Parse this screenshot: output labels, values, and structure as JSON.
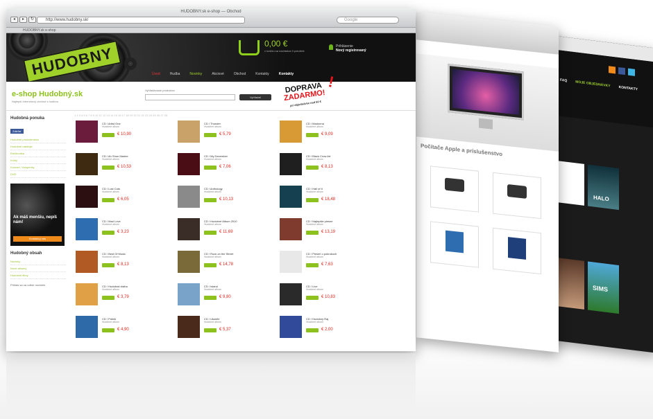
{
  "browser": {
    "window_title": "HUDOBNY.sk e-shop — Obchod",
    "address": "http://www.hudobny.sk/",
    "search_placeholder": "Google",
    "tab_label": "HUDOBNY.sk e-shop"
  },
  "site": {
    "logo": "HUDOBNY",
    "cart_total": "0,00 €",
    "cart_sub": "v košíku sa nachádza 0 položiek",
    "user_line1": "Prihlásenie",
    "user_line2": "Nový registrovaný",
    "menu": [
      "Úvod",
      "Hudba",
      "Novinky",
      "Akciové",
      "Obchod",
      "Kontakty",
      "Kontakty"
    ],
    "brand": "e-shop Hudobný.sk",
    "brand_sub": "Najlepší internetový obchod s hudbou",
    "search_label": "Vyhľadávanie produktov",
    "search_button": "Vyhľadať",
    "promo_line1": "DOPRAVA",
    "promo_line2": "ZADARMO!",
    "promo_line3": "pri objednávke nad 50 €"
  },
  "sidebar": {
    "title": "Hudobná ponuka",
    "fb_label": "Zdieľať",
    "links": [
      "Hudobné príslušenstvo",
      "Hudobné nástroje",
      "Elektronika",
      "Knihy",
      "Koncert, Vstupenky",
      "DVD"
    ],
    "banner_text": "Ak máš menšiu, nepíš nám!",
    "banner_button": "Kontaktuj nás",
    "title2": "Hudobný obsah",
    "links2": [
      "Novinky",
      "Nové albumy",
      "Hudobné filmy"
    ],
    "footer": "Prihlás sa na odber noviniek"
  },
  "pager": "1 2 3 4 5 6 7 8 9 10 11 12 13 14 15 16 17 18 19 20 21 22 23 24 25 26 27 28",
  "products": [
    {
      "name": "CD / Artist One",
      "sub": "Hudobné album",
      "price": "€ 10,90"
    },
    {
      "name": "CD / Thunder",
      "sub": "Hudobné album",
      "price": "€ 5,79"
    },
    {
      "name": "CD / Madonna",
      "sub": "Hudobné album",
      "price": "€ 9,09"
    },
    {
      "name": "CD / Ah Shun Mariee",
      "sub": "Hudobné album",
      "price": "€ 10,53"
    },
    {
      "name": "CD / My December",
      "sub": "Hudobné album",
      "price": "€ 7,06"
    },
    {
      "name": "CD / Black Crow Art",
      "sub": "Hudobné album",
      "price": "€ 8,13"
    },
    {
      "name": "CD / Lost Cuts",
      "sub": "Hudobné album",
      "price": "€ 6,05"
    },
    {
      "name": "CD / Anthology",
      "sub": "Hudobné album",
      "price": "€ 10,13"
    },
    {
      "name": "CD / Hall of It",
      "sub": "Hudobné album",
      "price": "€ 18,48"
    },
    {
      "name": "CD / Mad Love",
      "sub": "Hudobné album",
      "price": "€ 3,23"
    },
    {
      "name": "CD / Hudobné Album 2010",
      "sub": "Hudobné album",
      "price": "€ 11,69"
    },
    {
      "name": "CD / Najlepšie piesne",
      "sub": "Hudobné album",
      "price": "€ 13,19"
    },
    {
      "name": "CD / Best Of Music",
      "sub": "Hudobné album",
      "price": "€ 8,13"
    },
    {
      "name": "CD / Rock on the Street",
      "sub": "Hudobné album",
      "price": "€ 14,78"
    },
    {
      "name": "CD / Pieseň o pokrokoch",
      "sub": "Hudobné album",
      "price": "€ 7,63"
    },
    {
      "name": "CD / Hudobná dráha",
      "sub": "Hudobné album",
      "price": "€ 3,79"
    },
    {
      "name": "CD / Island",
      "sub": "Hudobné album",
      "price": "€ 9,80"
    },
    {
      "name": "CD / Live",
      "sub": "Hudobné album",
      "price": "€ 10,83"
    },
    {
      "name": "CD / Pútnik",
      "sub": "Hudobné album",
      "price": "€ 4,90"
    },
    {
      "name": "CD / Ukulele",
      "sub": "Hudobné album",
      "price": "€ 5,37"
    },
    {
      "name": "CD / Hudobný Raj",
      "sub": "Hudobné album",
      "price": "€ 2,00"
    }
  ],
  "cover_colors": [
    "#6b1b3c",
    "#c9a26a",
    "#d89a34",
    "#3d2a11",
    "#4a0d16",
    "#1f1f1f",
    "#2c0f10",
    "#8a8a8a",
    "#154050",
    "#2d6db0",
    "#3a2c26",
    "#803b2f",
    "#b25a23",
    "#7a6a3a",
    "#e8e8e8",
    "#e0a046",
    "#7aa3c9",
    "#2a2a2a",
    "#2f6aa8",
    "#4a2a1a",
    "#314a9a"
  ],
  "window2": {
    "headline": "Počítače Apple a príslušenstvo"
  },
  "window3": {
    "menu": [
      "FAQ",
      "MOJE OBJEDNÁVKY",
      "KONTAKTY"
    ],
    "game1": "HALO",
    "game2": "SIMS"
  }
}
